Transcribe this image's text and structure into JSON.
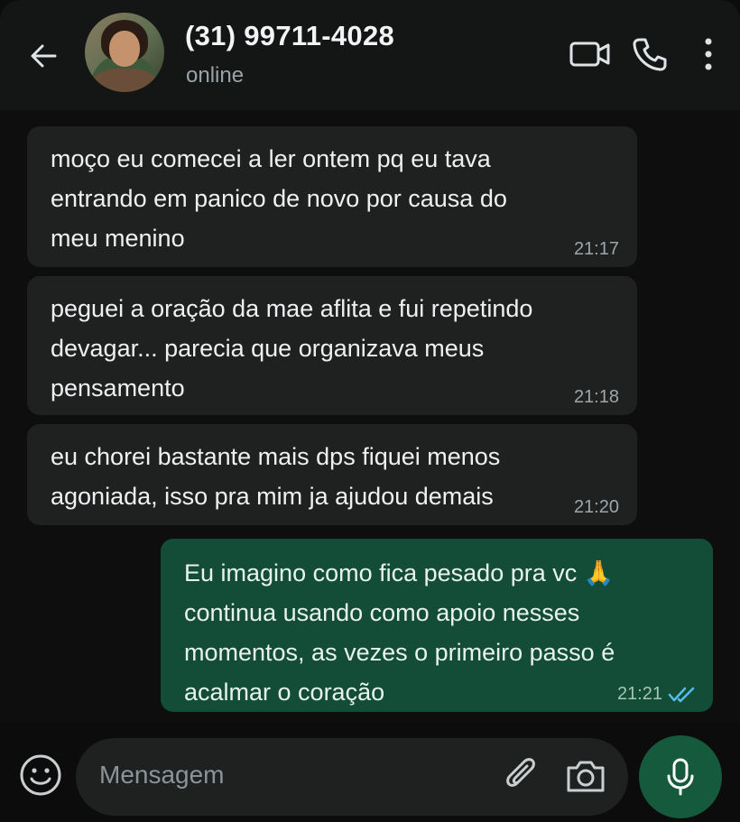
{
  "header": {
    "contact_name": "(31) 99711-4028",
    "status": "online"
  },
  "messages": [
    {
      "direction": "incoming",
      "text_lines": [
        "moço eu comecei a ler ontem pq eu tava",
        "entrando em panico de novo por causa do",
        "meu menino"
      ],
      "time": "21:17"
    },
    {
      "direction": "incoming",
      "text_lines": [
        "peguei a oração da mae aflita e fui repetindo",
        "devagar... parecia que organizava meus",
        "pensamento"
      ],
      "time": "21:18"
    },
    {
      "direction": "incoming",
      "text_lines": [
        "eu chorei bastante mais dps fiquei menos",
        "agoniada, isso pra mim ja ajudou demais"
      ],
      "time": "21:20"
    },
    {
      "direction": "outgoing",
      "text_lines": [
        "Eu imagino como fica pesado pra vc 🙏",
        "continua usando como apoio nesses",
        "momentos, as vezes o primeiro passo é",
        "acalmar o coração"
      ],
      "time": "21:21",
      "read": true
    }
  ],
  "composer": {
    "placeholder": "Mensagem"
  },
  "colors": {
    "outgoing_bubble": "#134d37",
    "incoming_bubble": "#1f2121",
    "mic_button": "#155a3c",
    "read_ticks": "#53bdeb"
  },
  "icons": {
    "back": "arrow-left",
    "video": "video-camera",
    "call": "phone",
    "menu": "three-dots-vertical",
    "emoji": "smiley",
    "attach": "paperclip",
    "camera": "camera",
    "voice": "microphone"
  }
}
